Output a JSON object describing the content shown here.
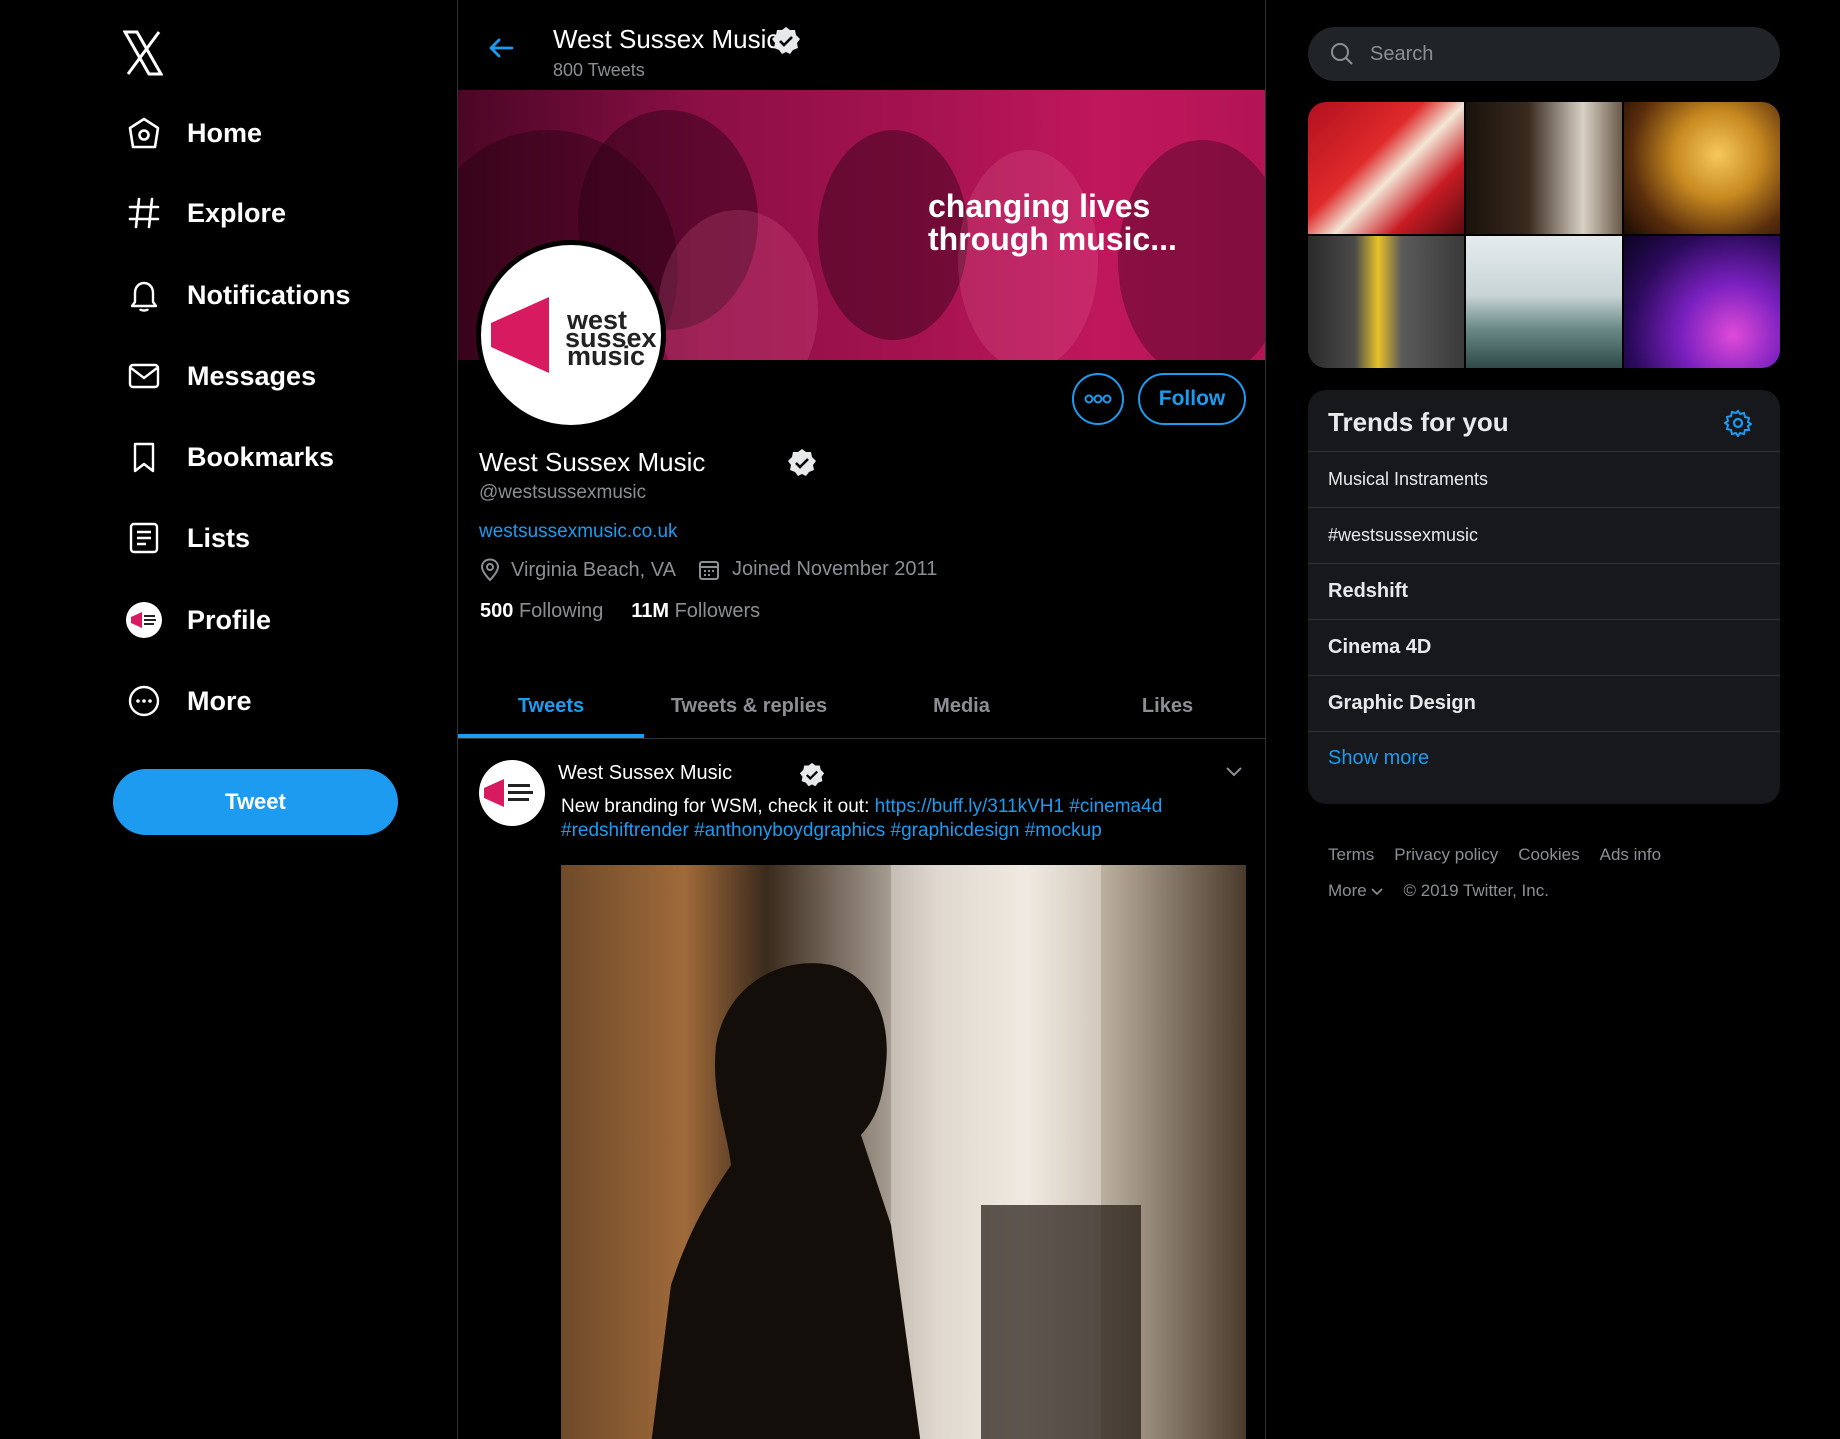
{
  "sidebar": {
    "logo": "x-logo-icon",
    "nav": [
      {
        "label": "Home",
        "icon": "home-icon"
      },
      {
        "label": "Explore",
        "icon": "hashtag-icon"
      },
      {
        "label": "Notifications",
        "icon": "bell-icon"
      },
      {
        "label": "Messages",
        "icon": "envelope-icon"
      },
      {
        "label": "Bookmarks",
        "icon": "bookmark-icon"
      },
      {
        "label": "Lists",
        "icon": "list-icon"
      },
      {
        "label": "Profile",
        "icon": "avatar"
      },
      {
        "label": "More",
        "icon": "more-circle-icon"
      }
    ],
    "tweet_button": "Tweet"
  },
  "header": {
    "name": "West Sussex Music",
    "tweet_count": "800 Tweets"
  },
  "banner": {
    "tagline": "changing lives\nthrough music..."
  },
  "avatar_logo": {
    "line1": "west",
    "line2": "sussex",
    "line3": "music"
  },
  "profile": {
    "name": "West Sussex Music",
    "handle": "@westsussexmusic",
    "url": "westsussexmusic.co.uk",
    "location": "Virginia Beach, VA",
    "joined": "Joined November 2011",
    "following_count": "500",
    "following_label": "Following",
    "followers_count": "11M",
    "followers_label": "Followers",
    "follow_button": "Follow"
  },
  "tabs": [
    "Tweets",
    "Tweets & replies",
    "Media",
    "Likes"
  ],
  "tweet": {
    "author": "West Sussex Music",
    "text": "New branding for WSM, check it out: ",
    "link": "https://buff.ly/311kVH1",
    "tags_line1": " #cinema4d",
    "tags_line2": "#redshiftrender #anthonyboydgraphics #graphicdesign #mockup"
  },
  "search": {
    "placeholder": "Search"
  },
  "trends": {
    "title": "Trends for you",
    "items": [
      "Musical Instraments",
      "#westsussexmusic",
      "Redshift",
      "Cinema 4D",
      "Graphic Design"
    ],
    "show_more": "Show more"
  },
  "footer": {
    "terms": "Terms",
    "privacy": "Privacy policy",
    "cookies": "Cookies",
    "ads": "Ads info",
    "more": "More",
    "copyright": "© 2019 Twitter, Inc."
  },
  "colors": {
    "accent": "#1d9bf0",
    "brand_pink": "#d81b60",
    "background": "#000000",
    "panel": "#16181c"
  }
}
